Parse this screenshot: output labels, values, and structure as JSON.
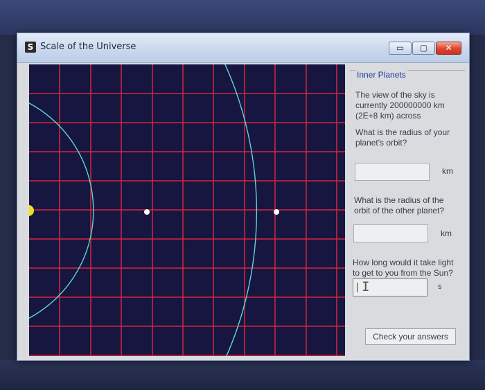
{
  "window": {
    "title": "Scale of the Universe",
    "app_icon": "S",
    "controls": {
      "minimize_glyph": "▭",
      "maximize_glyph": "▢",
      "close_glyph": "✕"
    }
  },
  "sky_view": {
    "grid_color": "#d3263f",
    "orbit_color": "#5fd6d6",
    "background_color": "#161640",
    "sun_color": "#f0e020",
    "planet_color": "#ffffff"
  },
  "panel": {
    "group_label": "Inner Planets",
    "description_line1": "The view of the sky is",
    "description_line2": "currently 200000000 km",
    "description_line3": "(2E+8 km) across",
    "question1_line1": "What is the radius of your",
    "question1_line2": "planet's orbit?",
    "answer1_value": "",
    "answer1_unit": "km",
    "question2_line1": "What is the radius of the",
    "question2_line2": "orbit of the other planet?",
    "answer2_value": "",
    "answer2_unit": "km",
    "question3_line1": "How long would it take light",
    "question3_line2": "to get to you from the Sun?",
    "answer3_value": "",
    "answer3_unit": "s",
    "check_button_label": "Check your answers"
  }
}
